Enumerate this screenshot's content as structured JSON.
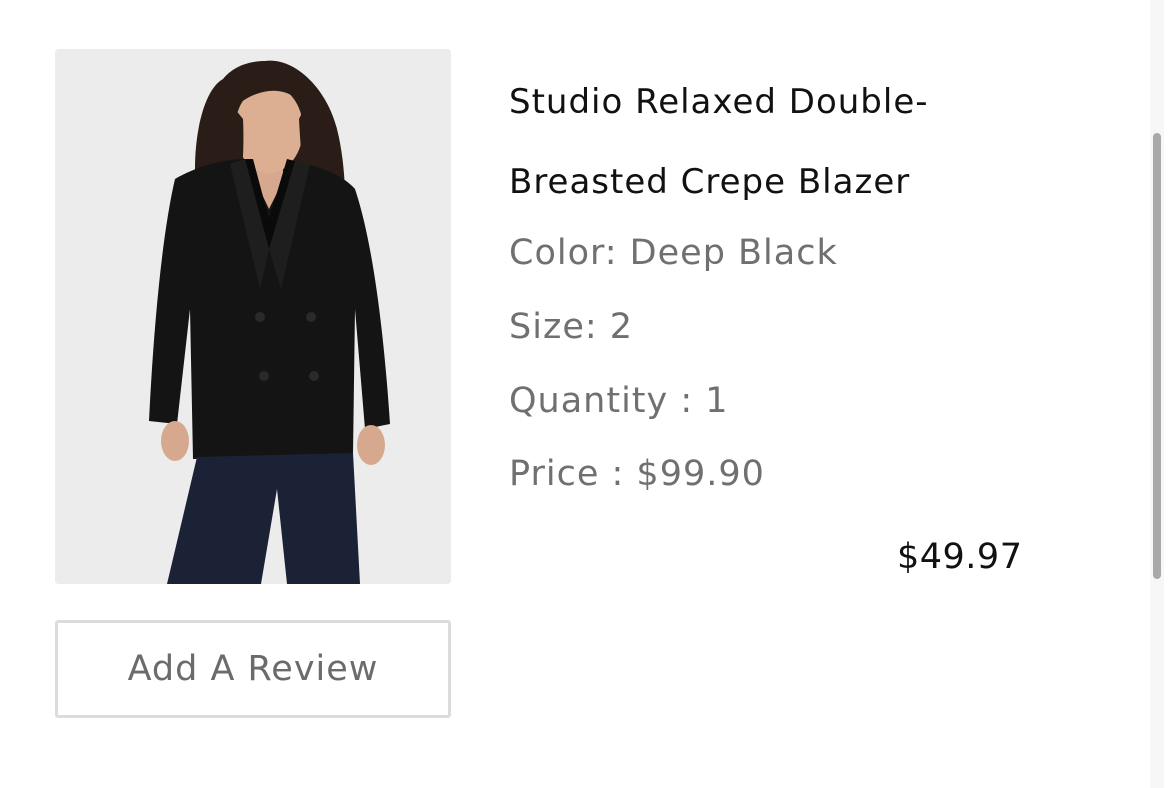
{
  "product": {
    "image_alt": "Studio Relaxed Double-Breasted Crepe Blazer",
    "title": "Studio Relaxed Double-Breasted Crepe Blazer",
    "color": "Color: Deep Black",
    "size": "Size: 2",
    "quantity": "Quantity : 1",
    "price": "Price : $99.90",
    "sale_price": "$49.97"
  },
  "actions": {
    "review_label": "Add A Review"
  },
  "colors": {
    "title": "#111111",
    "detail": "#707070",
    "button_border": "#dcdcdc",
    "image_bg": "#ececec",
    "garment": "#141414",
    "pants": "#1b2236"
  }
}
